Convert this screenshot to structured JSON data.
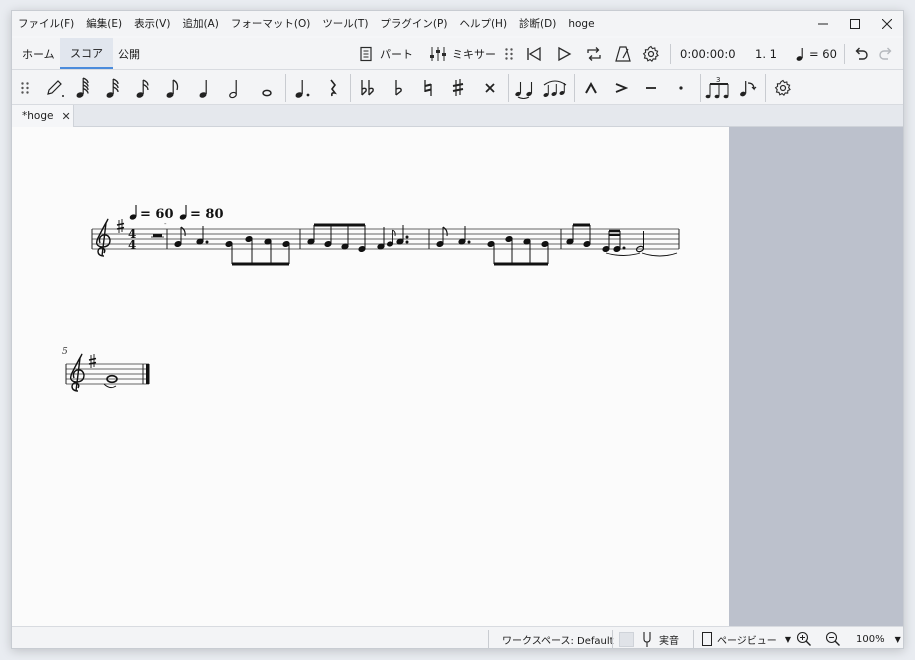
{
  "menubar": {
    "items": [
      "ファイル(F)",
      "編集(E)",
      "表示(V)",
      "追加(A)",
      "フォーマット(O)",
      "ツール(T)",
      "プラグイン(P)",
      "ヘルプ(H)",
      "診断(D)",
      "hoge"
    ]
  },
  "window_controls": {
    "minimize": "—",
    "maximize": "☐",
    "close": "✕"
  },
  "tabs": [
    {
      "label": "ホーム",
      "active": false
    },
    {
      "label": "スコア",
      "active": true
    },
    {
      "label": "公開",
      "active": false
    }
  ],
  "toolbar": {
    "parts_label": "パート",
    "mixer_label": "ミキサー",
    "time": "0:00:00:0",
    "position": "1. 1",
    "tempo": "= 60"
  },
  "palette": {
    "icons": [
      "pen-icon",
      "note-64th-icon",
      "note-32nd-icon",
      "note-16th-icon",
      "note-eighth-icon",
      "note-quarter-icon",
      "note-half-icon",
      "note-whole-icon",
      "augmentation-dot-icon",
      "rest-icon",
      "double-flat-icon",
      "flat-icon",
      "natural-icon",
      "sharp-icon",
      "double-sharp-icon",
      "tie-icon",
      "slur-icon",
      "marcato-icon",
      "accent-icon",
      "tenuto-icon",
      "staccato-icon",
      "tuplet-icon",
      "flip-icon",
      "settings-icon"
    ]
  },
  "document": {
    "tab_label": "*hoge",
    "close": "✕"
  },
  "score": {
    "tempo1": "= 60",
    "tempo2": "= 80",
    "measure_number": "5"
  },
  "statusbar": {
    "workspace": "ワークスペース: Default",
    "concert_pitch": "実音",
    "view_mode": "ページビュー",
    "zoom": "100%"
  },
  "colors": {
    "accent": "#4a8bdc",
    "score_bg": "#fbfbfb",
    "side_bg": "#bcc1cc"
  }
}
